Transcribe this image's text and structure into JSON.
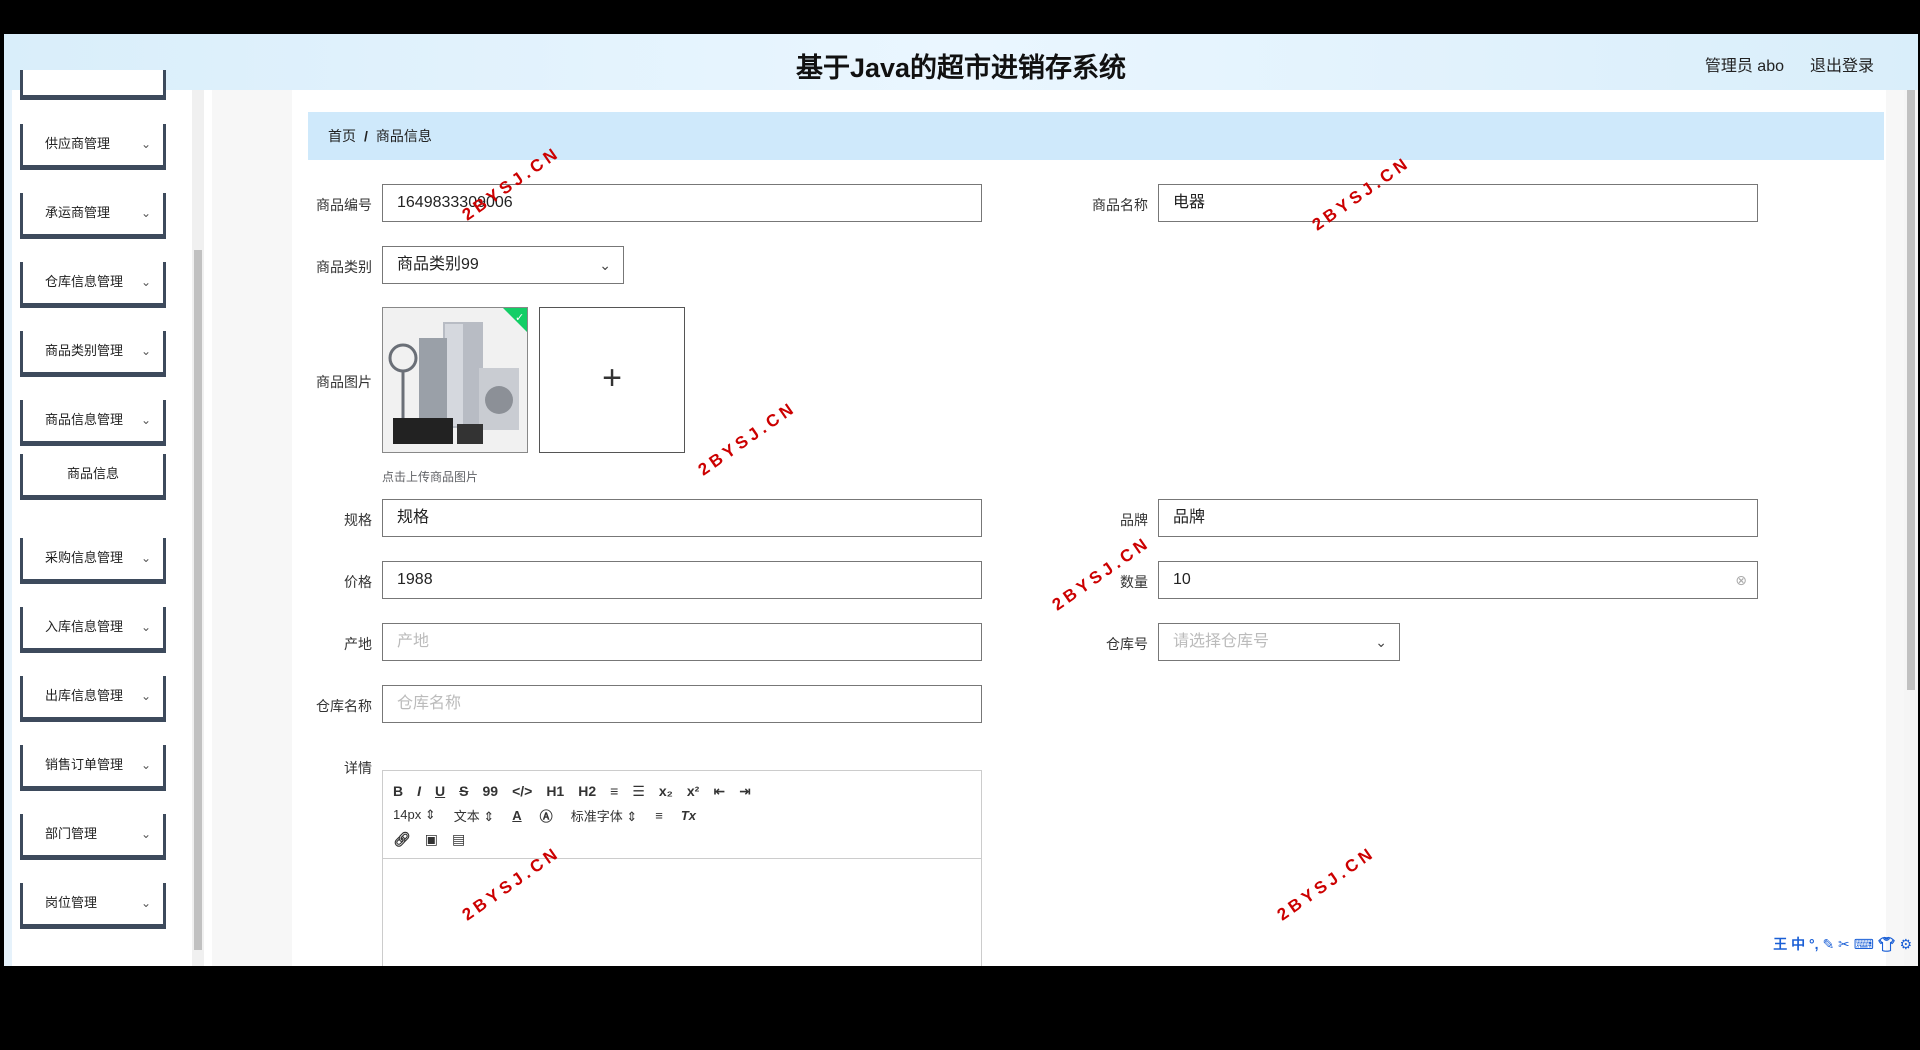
{
  "header": {
    "title": "基于Java的超市进销存系统",
    "user": "管理员 abo",
    "logout": "退出登录"
  },
  "sidebar": {
    "items": [
      {
        "label": "供应商管理"
      },
      {
        "label": "承运商管理"
      },
      {
        "label": "仓库信息管理"
      },
      {
        "label": "商品类别管理"
      },
      {
        "label": "商品信息管理"
      },
      {
        "label": "商品信息",
        "sub": true
      },
      {
        "label": "采购信息管理"
      },
      {
        "label": "入库信息管理"
      },
      {
        "label": "出库信息管理"
      },
      {
        "label": "销售订单管理"
      },
      {
        "label": "部门管理"
      },
      {
        "label": "岗位管理"
      }
    ]
  },
  "breadcrumb": {
    "home": "首页",
    "sep": "/",
    "current": "商品信息"
  },
  "form": {
    "code_label": "商品编号",
    "code_value": "1649833309006",
    "name_label": "商品名称",
    "name_value": "电器",
    "category_label": "商品类别",
    "category_value": "商品类别99",
    "image_label": "商品图片",
    "image_hint": "点击上传商品图片",
    "spec_label": "规格",
    "spec_value": "规格",
    "brand_label": "品牌",
    "brand_value": "品牌",
    "price_label": "价格",
    "price_value": "1988",
    "qty_label": "数量",
    "qty_value": "10",
    "origin_label": "产地",
    "origin_placeholder": "产地",
    "warehouse_no_label": "仓库号",
    "warehouse_no_placeholder": "请选择仓库号",
    "warehouse_name_label": "仓库名称",
    "warehouse_name_placeholder": "仓库名称",
    "detail_label": "详情"
  },
  "editor": {
    "row1": [
      "B",
      "I",
      "U",
      "S",
      "99",
      "</>",
      "H1",
      "H2",
      "≡",
      "☰",
      "x₂",
      "x²",
      "⇤",
      "⇥"
    ],
    "font_size": "14px",
    "text_style": "文本",
    "font_family": "标准字体"
  },
  "watermark": "2BYSJ.CN"
}
